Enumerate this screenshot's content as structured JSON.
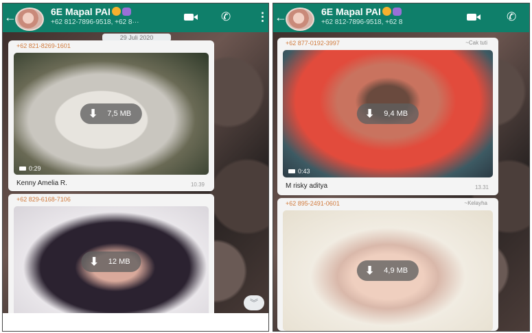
{
  "colors": {
    "header": "#0f7f6a",
    "sender_name": "#d07a3c",
    "bubble": "#f4f4f4"
  },
  "left": {
    "header": {
      "group_name": "6E Mapal PAI",
      "participants": "+62 812-7896-9518, +62 8···"
    },
    "date_chip": "29 Juli 2020",
    "messages": [
      {
        "sender_phone": "+62 821-8269-1601",
        "size": "7,5 MB",
        "duration": "0:29",
        "caption": "Kenny Amelia R.",
        "time": "10.39"
      },
      {
        "sender_phone": "+62 829-6168-7106",
        "size": "12 MB"
      }
    ]
  },
  "right": {
    "header": {
      "group_name": "6E Mapal PAI",
      "participants": "+62 812-7896-9518, +62 8"
    },
    "messages": [
      {
        "sender_phone": "+62 877-0192-3997",
        "sender_name": "~Cak tuti",
        "size": "9,4 MB",
        "duration": "0:43",
        "caption": "M risky aditya",
        "time": "13.31"
      },
      {
        "sender_phone": "+62 895-2491-0601",
        "sender_name": "~Kelayha",
        "size": "4,9 MB"
      }
    ]
  },
  "icons": {
    "back": "arrow-left-icon",
    "video_call": "video-camera-icon",
    "voice_call": "phone-icon",
    "menu": "kebab-menu-icon",
    "download": "download-arrow-icon",
    "scroll_down": "chevron-double-down-icon"
  }
}
